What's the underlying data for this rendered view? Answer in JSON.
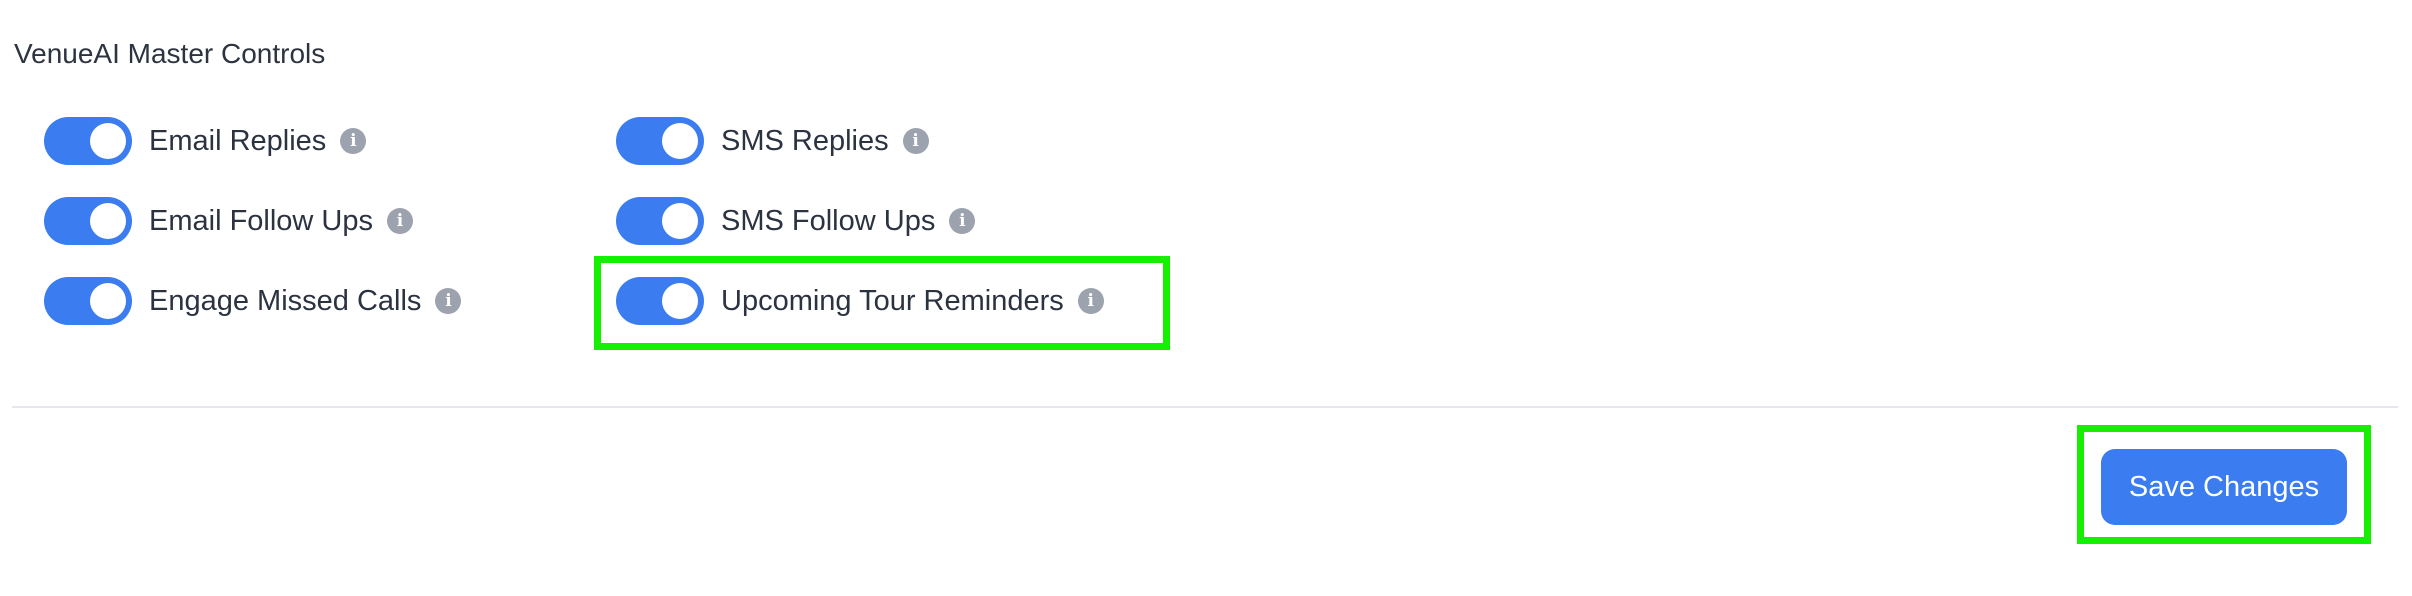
{
  "section": {
    "title": "VenueAI Master Controls"
  },
  "controls": [
    {
      "label": "Email Replies",
      "enabled": true
    },
    {
      "label": "Email Follow Ups",
      "enabled": true
    },
    {
      "label": "Engage Missed Calls",
      "enabled": true
    },
    {
      "label": "SMS Replies",
      "enabled": true
    },
    {
      "label": "SMS Follow Ups",
      "enabled": true
    },
    {
      "label": "Upcoming Tour Reminders",
      "enabled": true
    }
  ],
  "icons": {
    "info": "info-icon",
    "info_glyph": "i"
  },
  "actions": {
    "save_label": "Save Changes"
  },
  "colors": {
    "accent": "#3b7cf0",
    "highlight": "#15f000",
    "info_icon": "#9ca3ae"
  }
}
